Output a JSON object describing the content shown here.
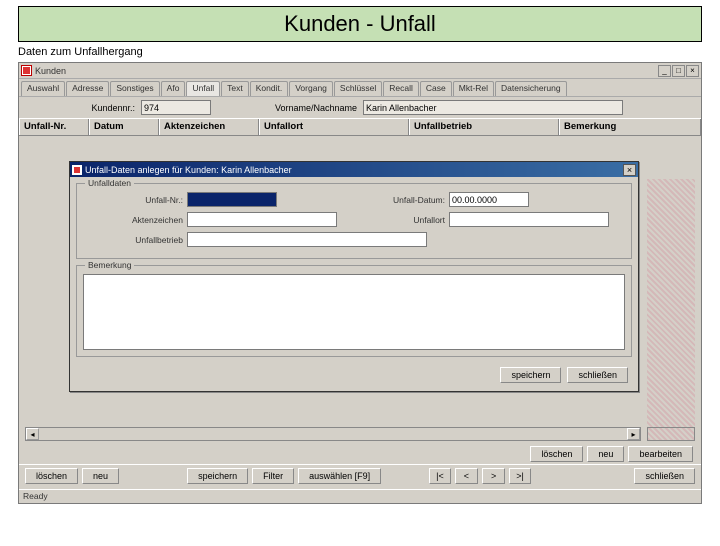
{
  "slide": {
    "title": "Kunden - Unfall",
    "subtitle": "Daten zum Unfallhergang"
  },
  "window": {
    "title": "Kunden",
    "tabs": [
      "Auswahl",
      "Adresse",
      "Sonstiges",
      "Afo",
      "Unfall",
      "Text",
      "Kondit.",
      "Vorgang",
      "Schlüssel",
      "Recall",
      "Case",
      "Mkt-Rel",
      "Datensicherung"
    ],
    "active_tab": 4,
    "kundennr_label": "Kundennr.:",
    "kundennr_value": "974",
    "name_label": "Vorname/Nachname",
    "name_value": "Karin Allenbacher",
    "columns": [
      "Unfall-Nr.",
      "Datum",
      "Aktenzeichen",
      "Unfallort",
      "Unfallbetrieb",
      "Bemerkung"
    ],
    "status": "Ready"
  },
  "dialog": {
    "title": "Unfall-Daten anlegen für Kunden: Karin Allenbacher",
    "group1": "Unfalldaten",
    "unfallnr_label": "Unfall-Nr.:",
    "unfallnr_value": "",
    "datum_label": "Unfall-Datum:",
    "datum_value": "00.00.0000",
    "akten_label": "Aktenzeichen",
    "akten_value": "",
    "ort_label": "Unfallort",
    "ort_value": "",
    "betrieb_label": "Unfallbetrieb",
    "betrieb_value": "",
    "group2": "Bemerkung",
    "btn_save": "speichern",
    "btn_close": "schließen"
  },
  "mainbtns": {
    "loeschen": "löschen",
    "neu": "neu",
    "speichern": "speichern",
    "filter": "Filter",
    "auswaehlen": "auswählen [F9]",
    "first": "|<",
    "prev": "<",
    "next": ">",
    "last": ">|",
    "schliessen": "schließen",
    "bearbeiten": "bearbeiten"
  },
  "rightbtns": {
    "loeschen": "löschen",
    "neu": "neu"
  }
}
